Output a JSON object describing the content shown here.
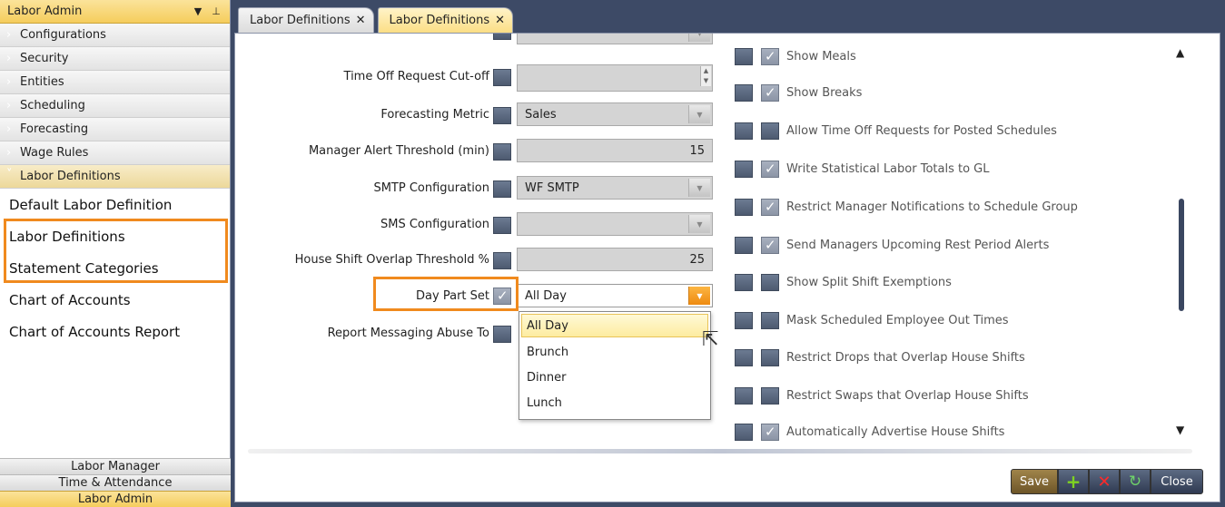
{
  "left_panel": {
    "header_title": "Labor Admin",
    "categories": [
      {
        "label": "Configurations"
      },
      {
        "label": "Security"
      },
      {
        "label": "Entities"
      },
      {
        "label": "Scheduling"
      },
      {
        "label": "Forecasting"
      },
      {
        "label": "Wage Rules"
      },
      {
        "label": "Labor Definitions"
      }
    ],
    "sub_items": [
      {
        "label": "Default Labor Definition"
      },
      {
        "label": "Labor Definitions"
      },
      {
        "label": "Statement Categories"
      },
      {
        "label": "Chart of Accounts"
      },
      {
        "label": "Chart of Accounts Report"
      }
    ],
    "bottom_tabs": [
      {
        "label": "Labor Manager"
      },
      {
        "label": "Time & Attendance"
      },
      {
        "label": "Labor Admin"
      }
    ]
  },
  "tabs": [
    {
      "label": "Labor Definitions",
      "active": false
    },
    {
      "label": "Labor Definitions",
      "active": true
    }
  ],
  "form": {
    "rows": [
      {
        "label": "Time Off Request Cut-off",
        "value": ""
      },
      {
        "label": "Forecasting Metric",
        "value": "Sales"
      },
      {
        "label": "Manager Alert Threshold (min)",
        "value": "15"
      },
      {
        "label": "SMTP Configuration",
        "value": "WF SMTP"
      },
      {
        "label": "SMS Configuration",
        "value": ""
      },
      {
        "label": "House Shift Overlap Threshold %",
        "value": "25"
      },
      {
        "label": "Day Part Set",
        "value": "All Day"
      },
      {
        "label": "Report Messaging Abuse To",
        "value": ""
      }
    ],
    "dropdown_options": [
      "All Day",
      "Brunch",
      "Dinner",
      "Lunch"
    ]
  },
  "right_options": [
    {
      "label": "Show Meals",
      "checked": true
    },
    {
      "label": "Show Breaks",
      "checked": true
    },
    {
      "label": "Allow Time Off Requests for Posted Schedules",
      "checked": false
    },
    {
      "label": "Write Statistical Labor Totals to GL",
      "checked": true
    },
    {
      "label": "Restrict Manager Notifications to Schedule Group",
      "checked": true
    },
    {
      "label": "Send Managers Upcoming Rest Period Alerts",
      "checked": true
    },
    {
      "label": "Show Split Shift Exemptions",
      "checked": false
    },
    {
      "label": "Mask Scheduled Employee Out Times",
      "checked": false
    },
    {
      "label": "Restrict Drops that Overlap House Shifts",
      "checked": false
    },
    {
      "label": "Restrict Swaps that Overlap House Shifts",
      "checked": false
    },
    {
      "label": "Automatically Advertise House Shifts",
      "checked": true
    }
  ],
  "toolbar": {
    "save_label": "Save",
    "close_label": "Close",
    "icons": [
      "plus-icon",
      "delete-icon",
      "refresh-icon"
    ]
  },
  "colors": {
    "accent_orange": "#f08a1e",
    "header_gold": "#f5cd5c",
    "frame_navy": "#3d4a66"
  }
}
